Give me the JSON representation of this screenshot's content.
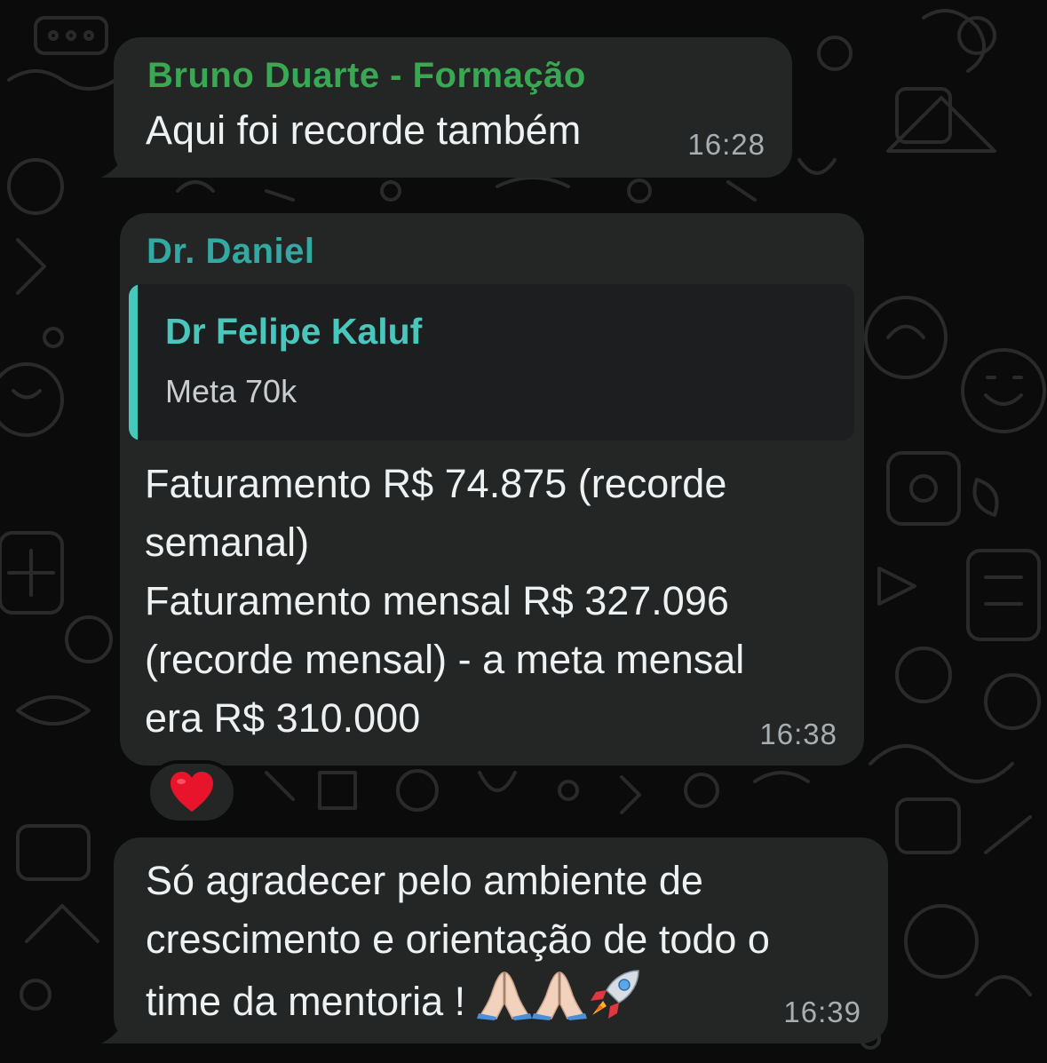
{
  "colors": {
    "bubble_bg": "#242626",
    "quote_bg": "#1c1e1f",
    "quote_accent": "#4ac7bc",
    "sender_green": "#3fbf5a",
    "sender_teal": "#35c1b8",
    "heart": "#e8142b"
  },
  "messages": [
    {
      "sender": "Bruno Duarte - Formação",
      "text": "Aqui foi recorde também",
      "time": "16:28"
    },
    {
      "sender": "Dr. Daniel",
      "quote": {
        "author": "Dr Felipe Kaluf",
        "text": "Meta 70k"
      },
      "lines": [
        "Faturamento R$ 74.875 (recorde",
        "semanal)",
        "Faturamento mensal R$ 327.096",
        "(recorde mensal) - a meta mensal",
        "era R$ 310.000"
      ],
      "time": "16:38",
      "reaction": "heart-emoji"
    },
    {
      "lines": [
        "Só agradecer pelo ambiente de",
        "crescimento e orientação de todo o",
        "time da mentoria ! "
      ],
      "emojis": [
        "folded-hands-emoji",
        "folded-hands-emoji",
        "rocket-emoji"
      ],
      "time": "16:39"
    }
  ]
}
